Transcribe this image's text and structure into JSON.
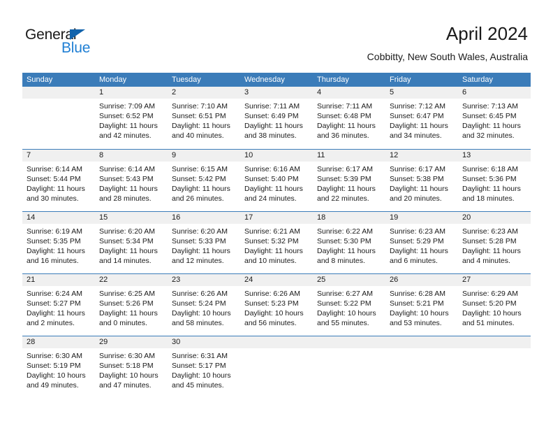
{
  "brand": {
    "name_part1": "General",
    "name_part2": "Blue",
    "accent_color": "#1f7fd4",
    "triangle_color": "#1263ac"
  },
  "header": {
    "title": "April 2024",
    "location": "Cobbitty, New South Wales, Australia"
  },
  "calendar": {
    "header_color": "#3b7cb9",
    "day_strip_color": "#f0f0f0",
    "weekdays": [
      "Sunday",
      "Monday",
      "Tuesday",
      "Wednesday",
      "Thursday",
      "Friday",
      "Saturday"
    ],
    "weeks": [
      [
        {
          "day": "",
          "empty": true
        },
        {
          "day": "1",
          "sunrise": "Sunrise: 7:09 AM",
          "sunset": "Sunset: 6:52 PM",
          "daylight1": "Daylight: 11 hours",
          "daylight2": "and 42 minutes."
        },
        {
          "day": "2",
          "sunrise": "Sunrise: 7:10 AM",
          "sunset": "Sunset: 6:51 PM",
          "daylight1": "Daylight: 11 hours",
          "daylight2": "and 40 minutes."
        },
        {
          "day": "3",
          "sunrise": "Sunrise: 7:11 AM",
          "sunset": "Sunset: 6:49 PM",
          "daylight1": "Daylight: 11 hours",
          "daylight2": "and 38 minutes."
        },
        {
          "day": "4",
          "sunrise": "Sunrise: 7:11 AM",
          "sunset": "Sunset: 6:48 PM",
          "daylight1": "Daylight: 11 hours",
          "daylight2": "and 36 minutes."
        },
        {
          "day": "5",
          "sunrise": "Sunrise: 7:12 AM",
          "sunset": "Sunset: 6:47 PM",
          "daylight1": "Daylight: 11 hours",
          "daylight2": "and 34 minutes."
        },
        {
          "day": "6",
          "sunrise": "Sunrise: 7:13 AM",
          "sunset": "Sunset: 6:45 PM",
          "daylight1": "Daylight: 11 hours",
          "daylight2": "and 32 minutes."
        }
      ],
      [
        {
          "day": "7",
          "sunrise": "Sunrise: 6:14 AM",
          "sunset": "Sunset: 5:44 PM",
          "daylight1": "Daylight: 11 hours",
          "daylight2": "and 30 minutes."
        },
        {
          "day": "8",
          "sunrise": "Sunrise: 6:14 AM",
          "sunset": "Sunset: 5:43 PM",
          "daylight1": "Daylight: 11 hours",
          "daylight2": "and 28 minutes."
        },
        {
          "day": "9",
          "sunrise": "Sunrise: 6:15 AM",
          "sunset": "Sunset: 5:42 PM",
          "daylight1": "Daylight: 11 hours",
          "daylight2": "and 26 minutes."
        },
        {
          "day": "10",
          "sunrise": "Sunrise: 6:16 AM",
          "sunset": "Sunset: 5:40 PM",
          "daylight1": "Daylight: 11 hours",
          "daylight2": "and 24 minutes."
        },
        {
          "day": "11",
          "sunrise": "Sunrise: 6:17 AM",
          "sunset": "Sunset: 5:39 PM",
          "daylight1": "Daylight: 11 hours",
          "daylight2": "and 22 minutes."
        },
        {
          "day": "12",
          "sunrise": "Sunrise: 6:17 AM",
          "sunset": "Sunset: 5:38 PM",
          "daylight1": "Daylight: 11 hours",
          "daylight2": "and 20 minutes."
        },
        {
          "day": "13",
          "sunrise": "Sunrise: 6:18 AM",
          "sunset": "Sunset: 5:36 PM",
          "daylight1": "Daylight: 11 hours",
          "daylight2": "and 18 minutes."
        }
      ],
      [
        {
          "day": "14",
          "sunrise": "Sunrise: 6:19 AM",
          "sunset": "Sunset: 5:35 PM",
          "daylight1": "Daylight: 11 hours",
          "daylight2": "and 16 minutes."
        },
        {
          "day": "15",
          "sunrise": "Sunrise: 6:20 AM",
          "sunset": "Sunset: 5:34 PM",
          "daylight1": "Daylight: 11 hours",
          "daylight2": "and 14 minutes."
        },
        {
          "day": "16",
          "sunrise": "Sunrise: 6:20 AM",
          "sunset": "Sunset: 5:33 PM",
          "daylight1": "Daylight: 11 hours",
          "daylight2": "and 12 minutes."
        },
        {
          "day": "17",
          "sunrise": "Sunrise: 6:21 AM",
          "sunset": "Sunset: 5:32 PM",
          "daylight1": "Daylight: 11 hours",
          "daylight2": "and 10 minutes."
        },
        {
          "day": "18",
          "sunrise": "Sunrise: 6:22 AM",
          "sunset": "Sunset: 5:30 PM",
          "daylight1": "Daylight: 11 hours",
          "daylight2": "and 8 minutes."
        },
        {
          "day": "19",
          "sunrise": "Sunrise: 6:23 AM",
          "sunset": "Sunset: 5:29 PM",
          "daylight1": "Daylight: 11 hours",
          "daylight2": "and 6 minutes."
        },
        {
          "day": "20",
          "sunrise": "Sunrise: 6:23 AM",
          "sunset": "Sunset: 5:28 PM",
          "daylight1": "Daylight: 11 hours",
          "daylight2": "and 4 minutes."
        }
      ],
      [
        {
          "day": "21",
          "sunrise": "Sunrise: 6:24 AM",
          "sunset": "Sunset: 5:27 PM",
          "daylight1": "Daylight: 11 hours",
          "daylight2": "and 2 minutes."
        },
        {
          "day": "22",
          "sunrise": "Sunrise: 6:25 AM",
          "sunset": "Sunset: 5:26 PM",
          "daylight1": "Daylight: 11 hours",
          "daylight2": "and 0 minutes."
        },
        {
          "day": "23",
          "sunrise": "Sunrise: 6:26 AM",
          "sunset": "Sunset: 5:24 PM",
          "daylight1": "Daylight: 10 hours",
          "daylight2": "and 58 minutes."
        },
        {
          "day": "24",
          "sunrise": "Sunrise: 6:26 AM",
          "sunset": "Sunset: 5:23 PM",
          "daylight1": "Daylight: 10 hours",
          "daylight2": "and 56 minutes."
        },
        {
          "day": "25",
          "sunrise": "Sunrise: 6:27 AM",
          "sunset": "Sunset: 5:22 PM",
          "daylight1": "Daylight: 10 hours",
          "daylight2": "and 55 minutes."
        },
        {
          "day": "26",
          "sunrise": "Sunrise: 6:28 AM",
          "sunset": "Sunset: 5:21 PM",
          "daylight1": "Daylight: 10 hours",
          "daylight2": "and 53 minutes."
        },
        {
          "day": "27",
          "sunrise": "Sunrise: 6:29 AM",
          "sunset": "Sunset: 5:20 PM",
          "daylight1": "Daylight: 10 hours",
          "daylight2": "and 51 minutes."
        }
      ],
      [
        {
          "day": "28",
          "sunrise": "Sunrise: 6:30 AM",
          "sunset": "Sunset: 5:19 PM",
          "daylight1": "Daylight: 10 hours",
          "daylight2": "and 49 minutes."
        },
        {
          "day": "29",
          "sunrise": "Sunrise: 6:30 AM",
          "sunset": "Sunset: 5:18 PM",
          "daylight1": "Daylight: 10 hours",
          "daylight2": "and 47 minutes."
        },
        {
          "day": "30",
          "sunrise": "Sunrise: 6:31 AM",
          "sunset": "Sunset: 5:17 PM",
          "daylight1": "Daylight: 10 hours",
          "daylight2": "and 45 minutes."
        },
        {
          "day": "",
          "empty": true
        },
        {
          "day": "",
          "empty": true
        },
        {
          "day": "",
          "empty": true
        },
        {
          "day": "",
          "empty": true
        }
      ]
    ]
  }
}
